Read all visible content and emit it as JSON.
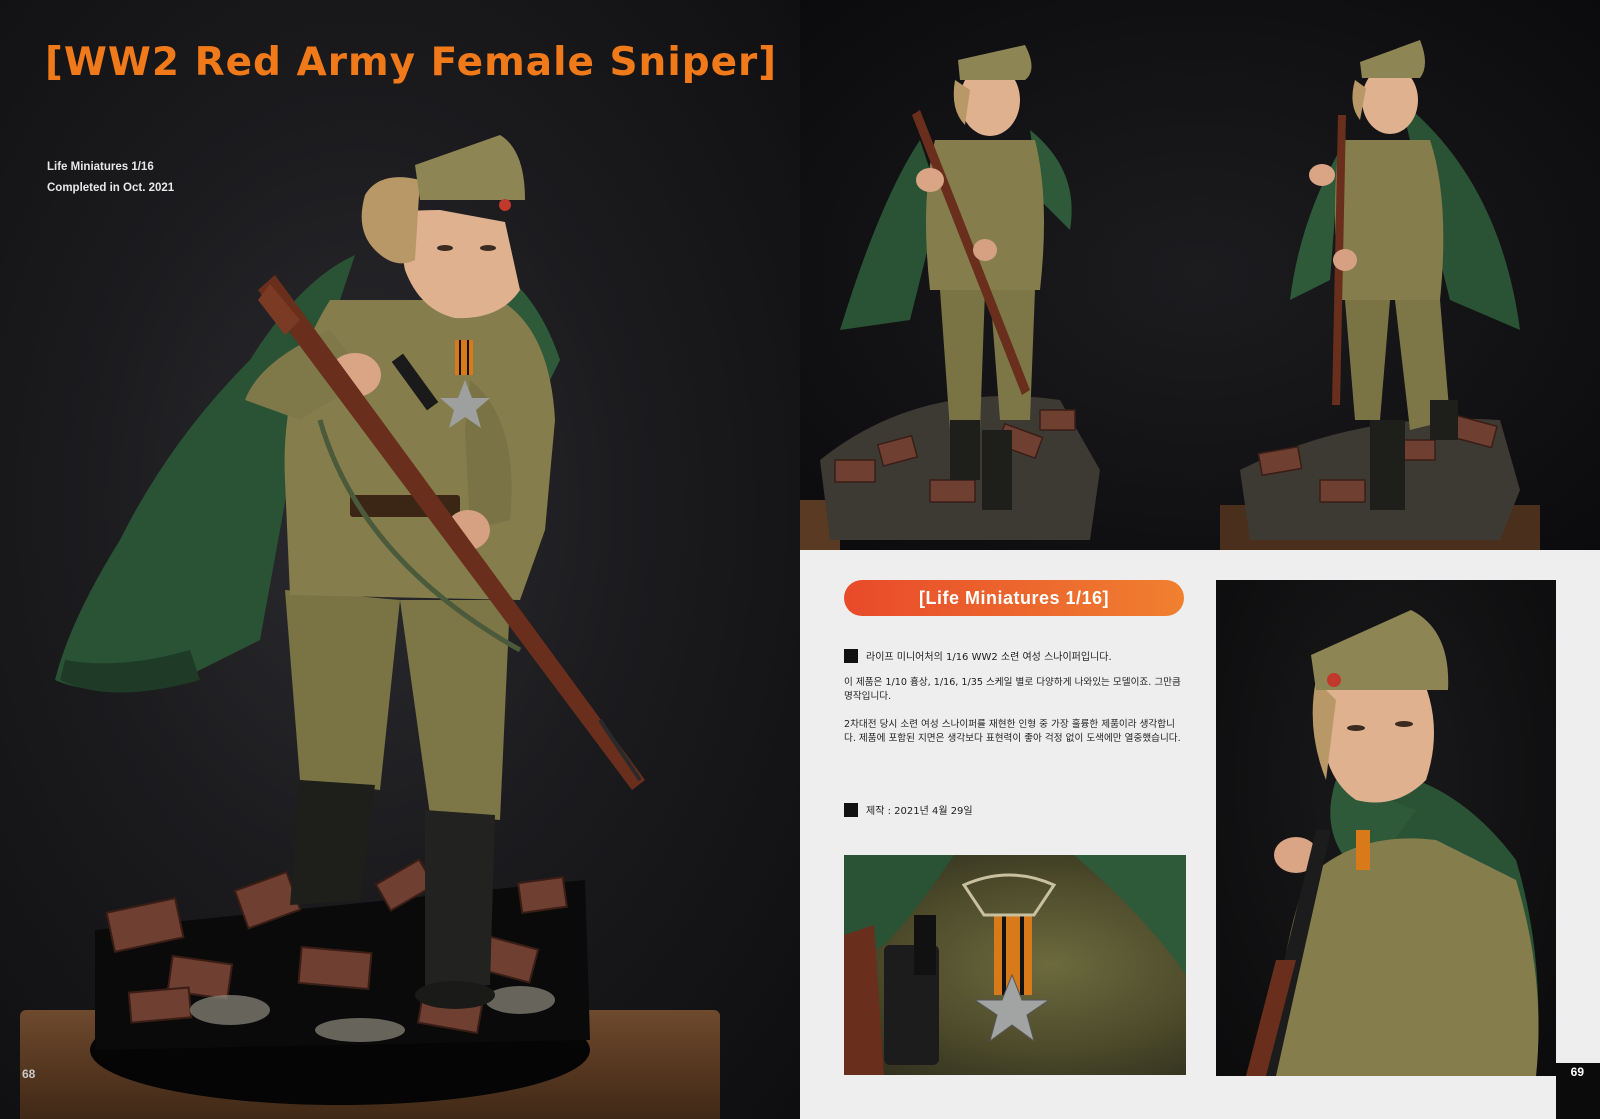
{
  "left_page": {
    "title": "[WW2 Red Army Female Sniper]",
    "meta_line_1": "Life Miniatures 1/16",
    "meta_line_2": "Completed in Oct. 2021",
    "page_number": "68"
  },
  "right_page": {
    "header_pill": "[Life Miniatures 1/16]",
    "bullet_1": "라이프 미니어처의 1/16 WW2 소련 여성 스나이퍼입니다.",
    "paragraph_1": "이 제품은 1/10 흉상, 1/16, 1/35 스케일 별로 다양하게 나와있는 모델이죠. 그만큼 명작입니다.",
    "paragraph_2": "2차대전 당시 소련 여성 스나이퍼를 재현한 인형 중 가장 훌륭한 제품이라 생각합니다. 제품에 포함된 지면은 생각보다 표현력이 좋아 걱정 없이 도색에만 열중했습니다.",
    "bullet_2": "제작 : 2021년 4월 29일",
    "page_number": "69"
  },
  "colors": {
    "title_orange": "#f07a1a",
    "pill_start": "#e84a2a",
    "pill_end": "#f08030",
    "uniform_khaki": "#7d7748",
    "cape_green": "#2f5a3a",
    "rifle_wood": "#6a2e1c"
  }
}
